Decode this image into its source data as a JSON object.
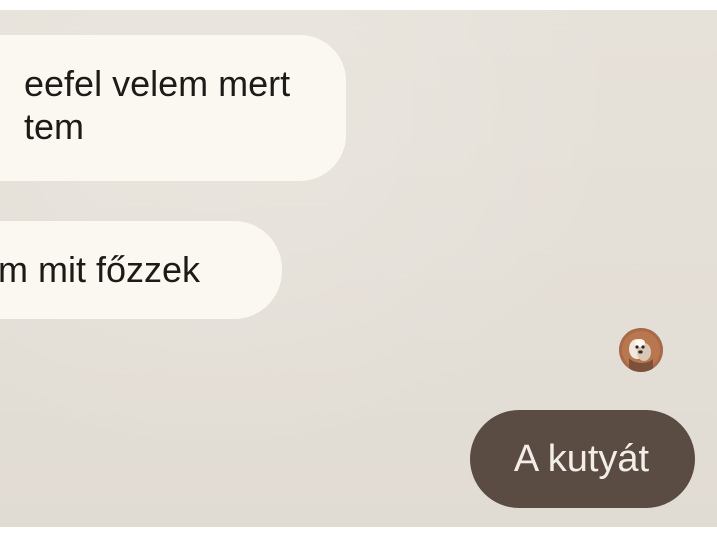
{
  "messages": [
    {
      "direction": "incoming",
      "lines": [
        "eefel velem mert",
        "tem"
      ]
    },
    {
      "direction": "incoming",
      "lines": [
        "m mit főzzek"
      ]
    },
    {
      "direction": "outgoing",
      "text": "A kutyát"
    }
  ],
  "avatar": {
    "icon": "dog-avatar-icon"
  },
  "colors": {
    "background": "#e4dfd7",
    "incoming_bubble": "#fbf8f2",
    "outgoing_bubble": "#5a4c43",
    "outgoing_text": "#f4eee8",
    "incoming_text": "#1d1a17"
  }
}
